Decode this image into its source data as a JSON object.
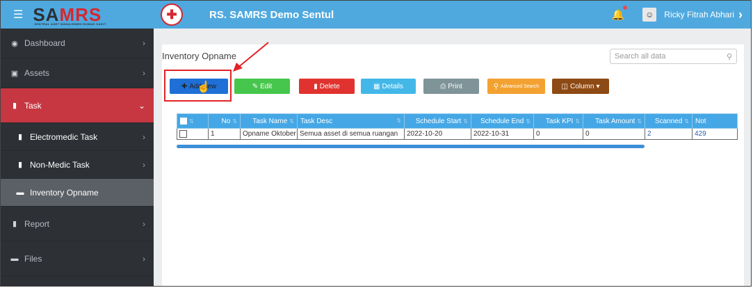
{
  "sidebar": {
    "brand": "SAMRS",
    "brand_part1": "SA",
    "brand_part2": "MRS",
    "brand_sub": "SENTRAL ASET MANAJEMEN RUMAH SAKIT",
    "items": [
      {
        "label": "Dashboard",
        "icon": "palette-icon"
      },
      {
        "label": "Assets",
        "icon": "cubes-icon"
      },
      {
        "label": "Task",
        "icon": "clipboard-icon"
      },
      {
        "label": "Electromedic Task",
        "icon": "file-icon"
      },
      {
        "label": "Non-Medic Task",
        "icon": "clipboard-icon"
      },
      {
        "label": "Inventory Opname",
        "icon": "archive-icon"
      },
      {
        "label": "Report",
        "icon": "clipboard-icon"
      },
      {
        "label": "Files",
        "icon": "folder-icon"
      }
    ]
  },
  "header": {
    "hospital_name": "RS. SAMRS Demo Sentul",
    "user_name": "Ricky Fitrah Abhari"
  },
  "page": {
    "title": "Inventory Opname",
    "search_placeholder": "Search all data"
  },
  "toolbar": {
    "add": "Add new",
    "edit": "Edit",
    "delete": "Delete",
    "details": "Details",
    "print": "Print",
    "advanced_search": "Advanced Search",
    "column": "Column"
  },
  "table": {
    "columns": [
      "No",
      "Task Name",
      "Task Desc",
      "Schedule Start",
      "Schedule End",
      "Task KPI",
      "Task Amount",
      "Scanned",
      "Not"
    ],
    "rows": [
      [
        "1",
        "Opname Oktober",
        "Semua asset di semua ruangan",
        "2022-10-20",
        "2022-10-31",
        "0",
        "0",
        "2",
        "429"
      ]
    ]
  },
  "colors": {
    "topbar": "#4fa9de",
    "sidebar": "#2d3035",
    "task_active": "#c73742",
    "highlight": "#e22326"
  }
}
